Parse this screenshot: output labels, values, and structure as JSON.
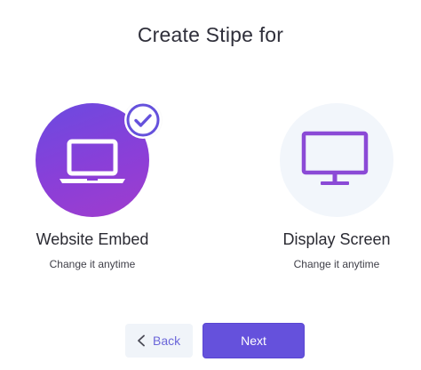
{
  "header": {
    "title": "Create Stipe for"
  },
  "options": [
    {
      "label": "Website Embed",
      "subtitle": "Change it anytime",
      "icon": "laptop-icon",
      "selected": true
    },
    {
      "label": "Display Screen",
      "subtitle": "Change it anytime",
      "icon": "monitor-icon",
      "selected": false
    }
  ],
  "footer": {
    "back_label": "Back",
    "next_label": "Next"
  },
  "colors": {
    "accent": "#6551dc",
    "selected_gradient_start": "#6b4ae0",
    "selected_gradient_end": "#a03ccd",
    "unselected_bg": "#f2f6fb",
    "monitor_icon": "#8b4ad6"
  }
}
